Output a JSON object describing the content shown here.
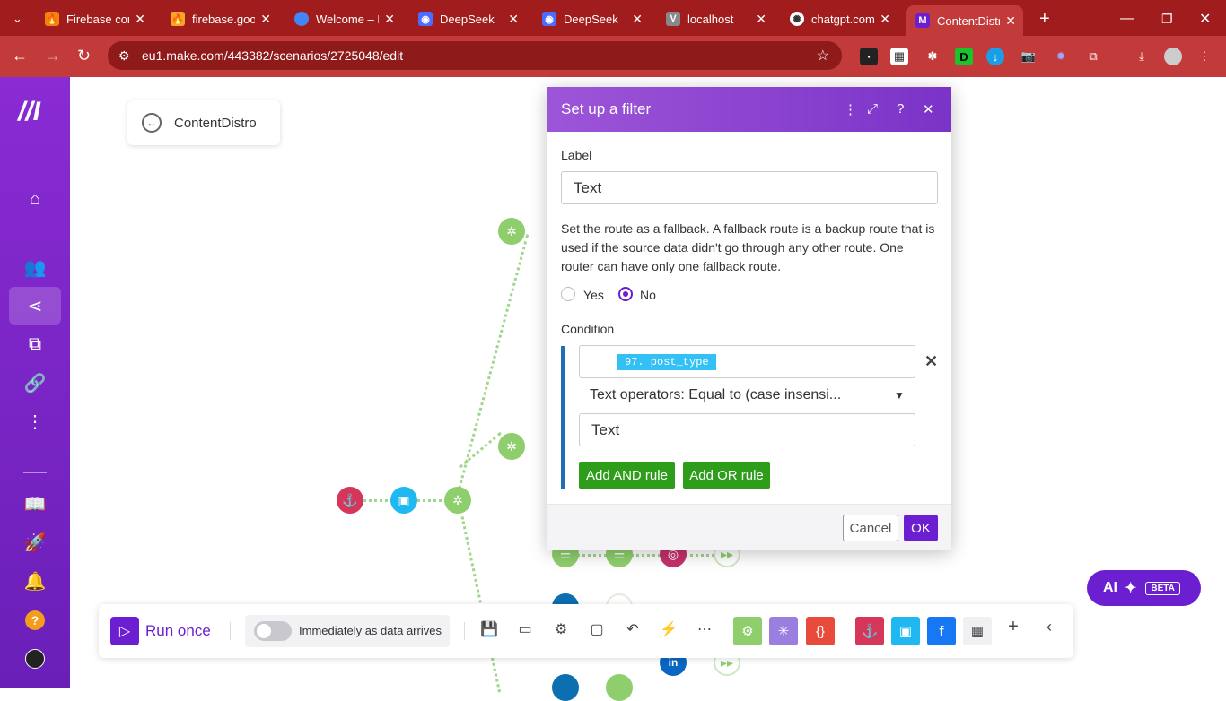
{
  "browser": {
    "tabs": [
      {
        "title": "Firebase con",
        "icon": "firebase-icon",
        "color": "#f5820d"
      },
      {
        "title": "firebase.goo",
        "icon": "firebase-icon",
        "color": "#f5a623"
      },
      {
        "title": "Welcome – D",
        "icon": "google-cloud-icon",
        "color": "#4285f4"
      },
      {
        "title": "DeepSeek",
        "icon": "deepseek-icon",
        "color": "#4d6bfe"
      },
      {
        "title": "DeepSeek",
        "icon": "deepseek-icon",
        "color": "#4d6bfe"
      },
      {
        "title": "localhost",
        "icon": "v-icon",
        "color": "#888888"
      },
      {
        "title": "chatgpt.com",
        "icon": "openai-icon",
        "color": "#ffffff"
      },
      {
        "title": "ContentDistr",
        "icon": "make-icon",
        "color": "#6c1fd0"
      }
    ],
    "url": "eu1.make.com/443382/scenarios/2725048/edit"
  },
  "scenario": {
    "name": "ContentDistro"
  },
  "modal": {
    "title": "Set up a filter",
    "label_heading": "Label",
    "label_value": "Text",
    "fallback_description": "Set the route as a fallback. A fallback route is a backup route that is used if the source data didn't go through any other route. One router can have only one fallback route.",
    "radio_yes": "Yes",
    "radio_no": "No",
    "fallback_selected": "No",
    "condition_heading": "Condition",
    "condition_field_tag": "97. post_type",
    "operator": "Text operators: Equal to (case insensi...",
    "condition_value": "Text",
    "add_and": "Add AND rule",
    "add_or": "Add OR rule",
    "cancel": "Cancel",
    "ok": "OK"
  },
  "toolbar": {
    "run_once": "Run once",
    "schedule_text": "Immediately as data arrives"
  },
  "ai_button": {
    "label": "AI",
    "badge": "BETA"
  },
  "colors": {
    "brand_purple": "#6c1fd0",
    "browser_red": "#c23a3a",
    "router_green": "#8fce6d",
    "add_rule_green": "#2d9d1a"
  }
}
